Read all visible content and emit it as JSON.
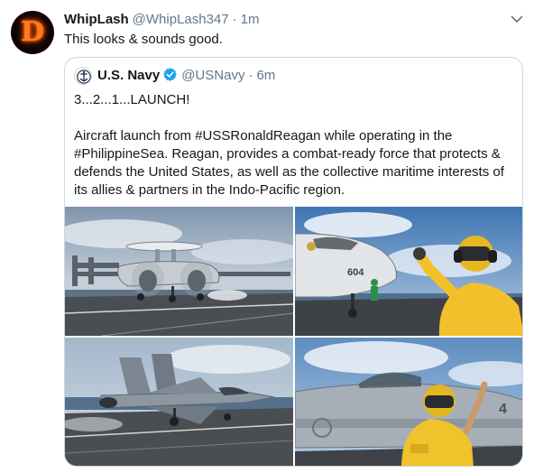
{
  "tweet": {
    "author_name": "WhipLash",
    "author_handle": "@WhipLash347",
    "separator": "·",
    "time": "1m",
    "avatar_letter": "D",
    "text": "This looks & sounds good.",
    "menu_icon": "chevron-down-icon"
  },
  "quoted": {
    "author_name": "U.S. Navy",
    "author_handle": "@USNavy",
    "separator": "·",
    "time": "6m",
    "verified_icon": "verified-badge-icon",
    "text_line1": "3...2...1...LAUNCH!",
    "text_body": "Aircraft launch from #USSRonaldReagan while operating in the #PhilippineSea. Reagan, provides a combat-ready force that protects & defends the United States, as well as the collective maritime interests of its allies & partners in the Indo-Pacific region.",
    "photos": [
      {
        "name": "e2-hawkeye-launch-photo"
      },
      {
        "name": "shooter-signal-photo",
        "visible_number": "604"
      },
      {
        "name": "super-hornet-launch-photo"
      },
      {
        "name": "flight-deck-crew-photo",
        "visible_number": "4"
      }
    ]
  },
  "colors": {
    "text": "#14171a",
    "secondary": "#657786",
    "border": "#ccd6dd",
    "verified": "#1da1f2"
  }
}
